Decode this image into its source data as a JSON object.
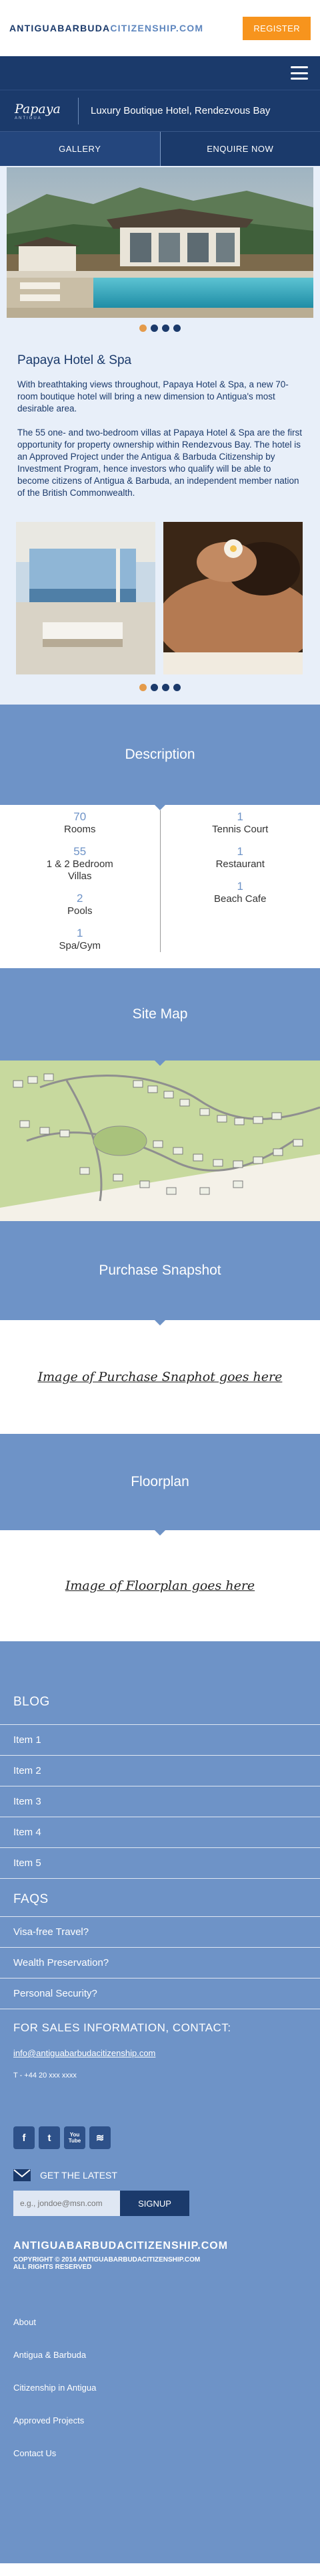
{
  "header": {
    "brand_part1": "ANTIGUA",
    "brand_part2": "BARBUDA",
    "brand_part3": "CITIZENSHIP",
    "brand_part4": ".COM",
    "register_label": "REGISTER"
  },
  "hotel_header": {
    "logo_text": "Papaya",
    "logo_subtext": "ANTIGUA",
    "tagline": "Luxury Boutique Hotel, Rendezvous Bay"
  },
  "action_buttons": {
    "gallery": "GALLERY",
    "enquire": "ENQUIRE NOW"
  },
  "intro": {
    "title": "Papaya Hotel & Spa",
    "para1": "With breathtaking views throughout, Papaya Hotel & Spa, a new 70-room boutique hotel will bring a new dimension to Antigua's most desirable area.",
    "para2": "The 55 one- and two-bedroom villas at Papaya Hotel & Spa are the first opportunity for property ownership within Rendezvous Bay. The hotel is an Approved Project under the Antigua & Barbuda Citizenship by Investment Program, hence investors who qualify will be able to become citizens of Antigua & Barbuda, an independent member nation of the British Commonwealth."
  },
  "description": {
    "heading": "Description",
    "left": [
      {
        "num": "70",
        "label": "Rooms"
      },
      {
        "num": "55",
        "label": "1 & 2 Bedroom Villas"
      },
      {
        "num": "2",
        "label": "Pools"
      },
      {
        "num": "1",
        "label": "Spa/Gym"
      }
    ],
    "right": [
      {
        "num": "1",
        "label": "Tennis Court"
      },
      {
        "num": "1",
        "label": "Restaurant"
      },
      {
        "num": "1",
        "label": "Beach Cafe"
      }
    ]
  },
  "sitemap": {
    "heading": "Site Map"
  },
  "purchase": {
    "heading": "Purchase Snapshot",
    "placeholder": "Image of  Purchase Snaphot goes here"
  },
  "floorplan": {
    "heading": "Floorplan",
    "placeholder": "Image of  Floorplan goes here"
  },
  "footer": {
    "blog_heading": "BLOG",
    "blog_items": [
      "Item 1",
      "Item 2",
      "Item 3",
      "Item 4",
      "Item 5"
    ],
    "faqs_heading": "FAQS",
    "faq_items": [
      "Visa-free Travel?",
      "Wealth Preservation?",
      "Personal Security?"
    ],
    "sales_heading": "FOR SALES INFORMATION, CONTACT:",
    "email": "info@antiguabarbudacitizenship.com",
    "phone": "T - +44 20 xxx xxxx",
    "social_icons": [
      "facebook-icon",
      "twitter-icon",
      "youtube-icon",
      "rss-icon"
    ],
    "social_glyphs": {
      "facebook": "f",
      "twitter": "t",
      "youtube_top": "You",
      "youtube_bottom": "Tube",
      "rss": "≋"
    },
    "latest_label": "GET THE LATEST",
    "signup_placeholder": "e.g., jondoe@msn.com",
    "signup_button": "SIGNUP",
    "site_name": "ANTIGUABARBUDACITIZENSHIP.COM",
    "copyright": "COPYRIGHT © 2014 ANTIGUABARBUDACITIZENSHIP.COM",
    "rights": "ALL RIGHTS RESERVED",
    "links": [
      "About",
      "Antigua & Barbuda",
      "Citizenship in Antigua",
      "Approved Projects",
      "Contact Us"
    ]
  },
  "colors": {
    "navy": "#1b3a6b",
    "steel_blue": "#6e93c7",
    "orange": "#f7941d",
    "light_bg": "#e8eff9"
  },
  "carousel_1": {
    "dot_count": 4,
    "active_index": 0
  },
  "carousel_2": {
    "dot_count": 4,
    "active_index": 0
  }
}
